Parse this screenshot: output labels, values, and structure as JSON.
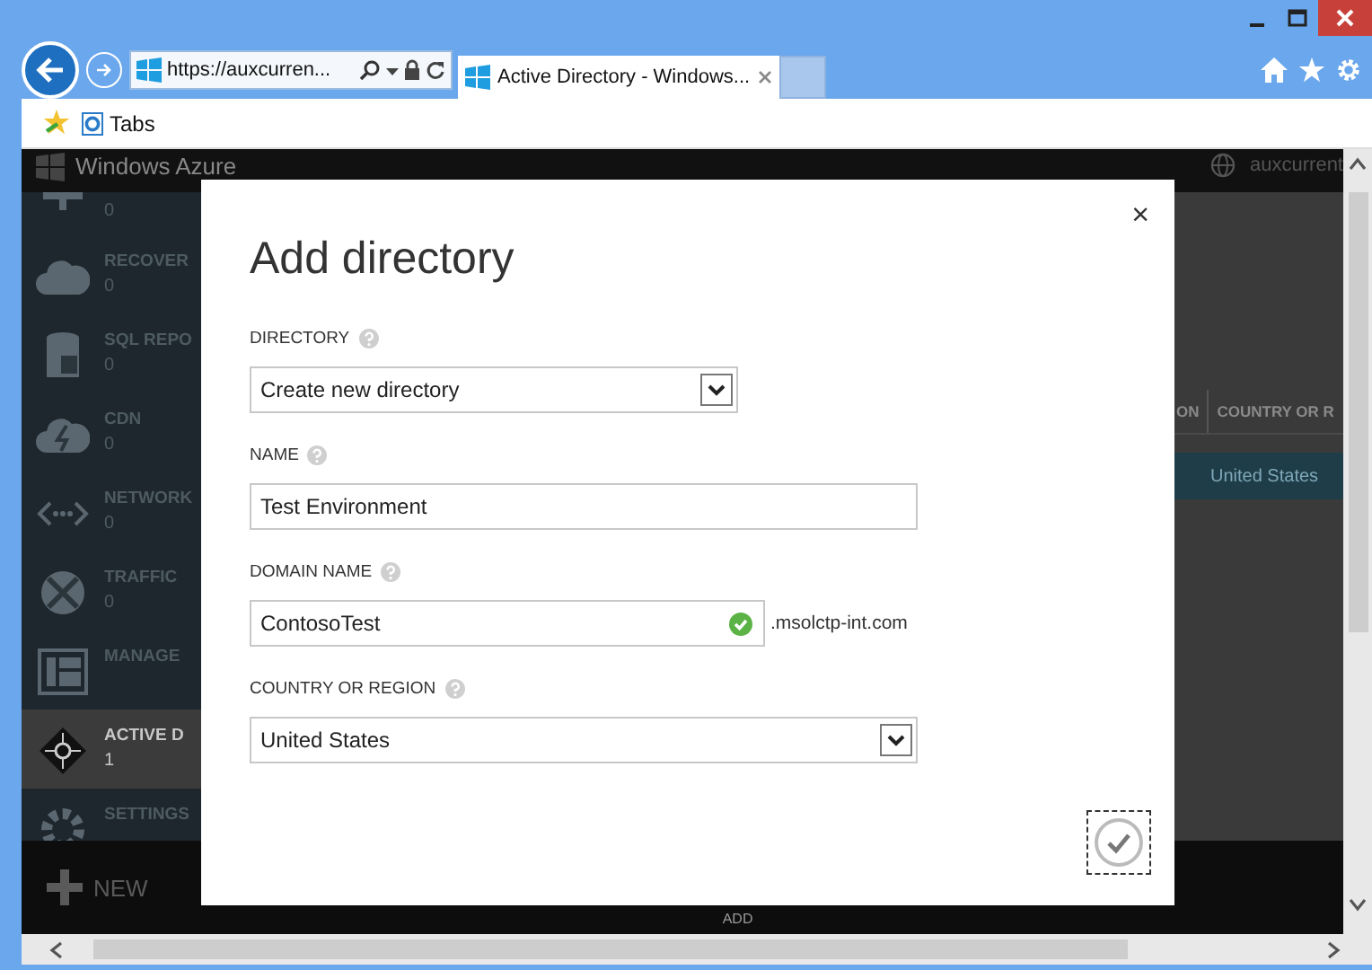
{
  "browser": {
    "address": "https://auxcurren...",
    "tabs": [
      {
        "label": "Active Directory - Windows...",
        "selected": true
      }
    ],
    "favorites": [
      {
        "label": "Tabs"
      }
    ]
  },
  "portal": {
    "brand": "Windows Azure",
    "account": "auxcurrent",
    "sidebar": [
      {
        "count": "0",
        "selected": false
      },
      {
        "label": "RECOVER",
        "count": "0",
        "selected": false
      },
      {
        "label": "SQL REPO",
        "count": "0",
        "selected": false
      },
      {
        "label": "CDN",
        "count": "0",
        "selected": false
      },
      {
        "label": "NETWORK",
        "count": "0",
        "selected": false
      },
      {
        "label": "TRAFFIC",
        "count": "0",
        "selected": false
      },
      {
        "label": "MANAGE",
        "selected": false
      },
      {
        "label": "ACTIVE D",
        "count": "1",
        "selected": true
      },
      {
        "label": "SETTINGS",
        "selected": false
      }
    ],
    "table": {
      "columns": [
        "ON",
        "COUNTRY OR R"
      ],
      "rows": [
        {
          "column_2": "United States",
          "selected": true
        }
      ]
    },
    "command_bar": {
      "new_label": "NEW",
      "actions": [
        "ADD"
      ]
    }
  },
  "dialog": {
    "title": "Add directory",
    "close": "×",
    "fields": [
      {
        "kind": "select",
        "label": "DIRECTORY",
        "value": "Create new directory"
      },
      {
        "kind": "text",
        "label": "NAME",
        "value": "Test Environment"
      },
      {
        "kind": "text",
        "label": "DOMAIN NAME",
        "value": "ContosoTest",
        "valid": true,
        "suffix": ".msolctp-int.com"
      },
      {
        "kind": "select",
        "label": "COUNTRY OR REGION",
        "value": "United States"
      }
    ],
    "confirm": {
      "focused": true
    }
  }
}
